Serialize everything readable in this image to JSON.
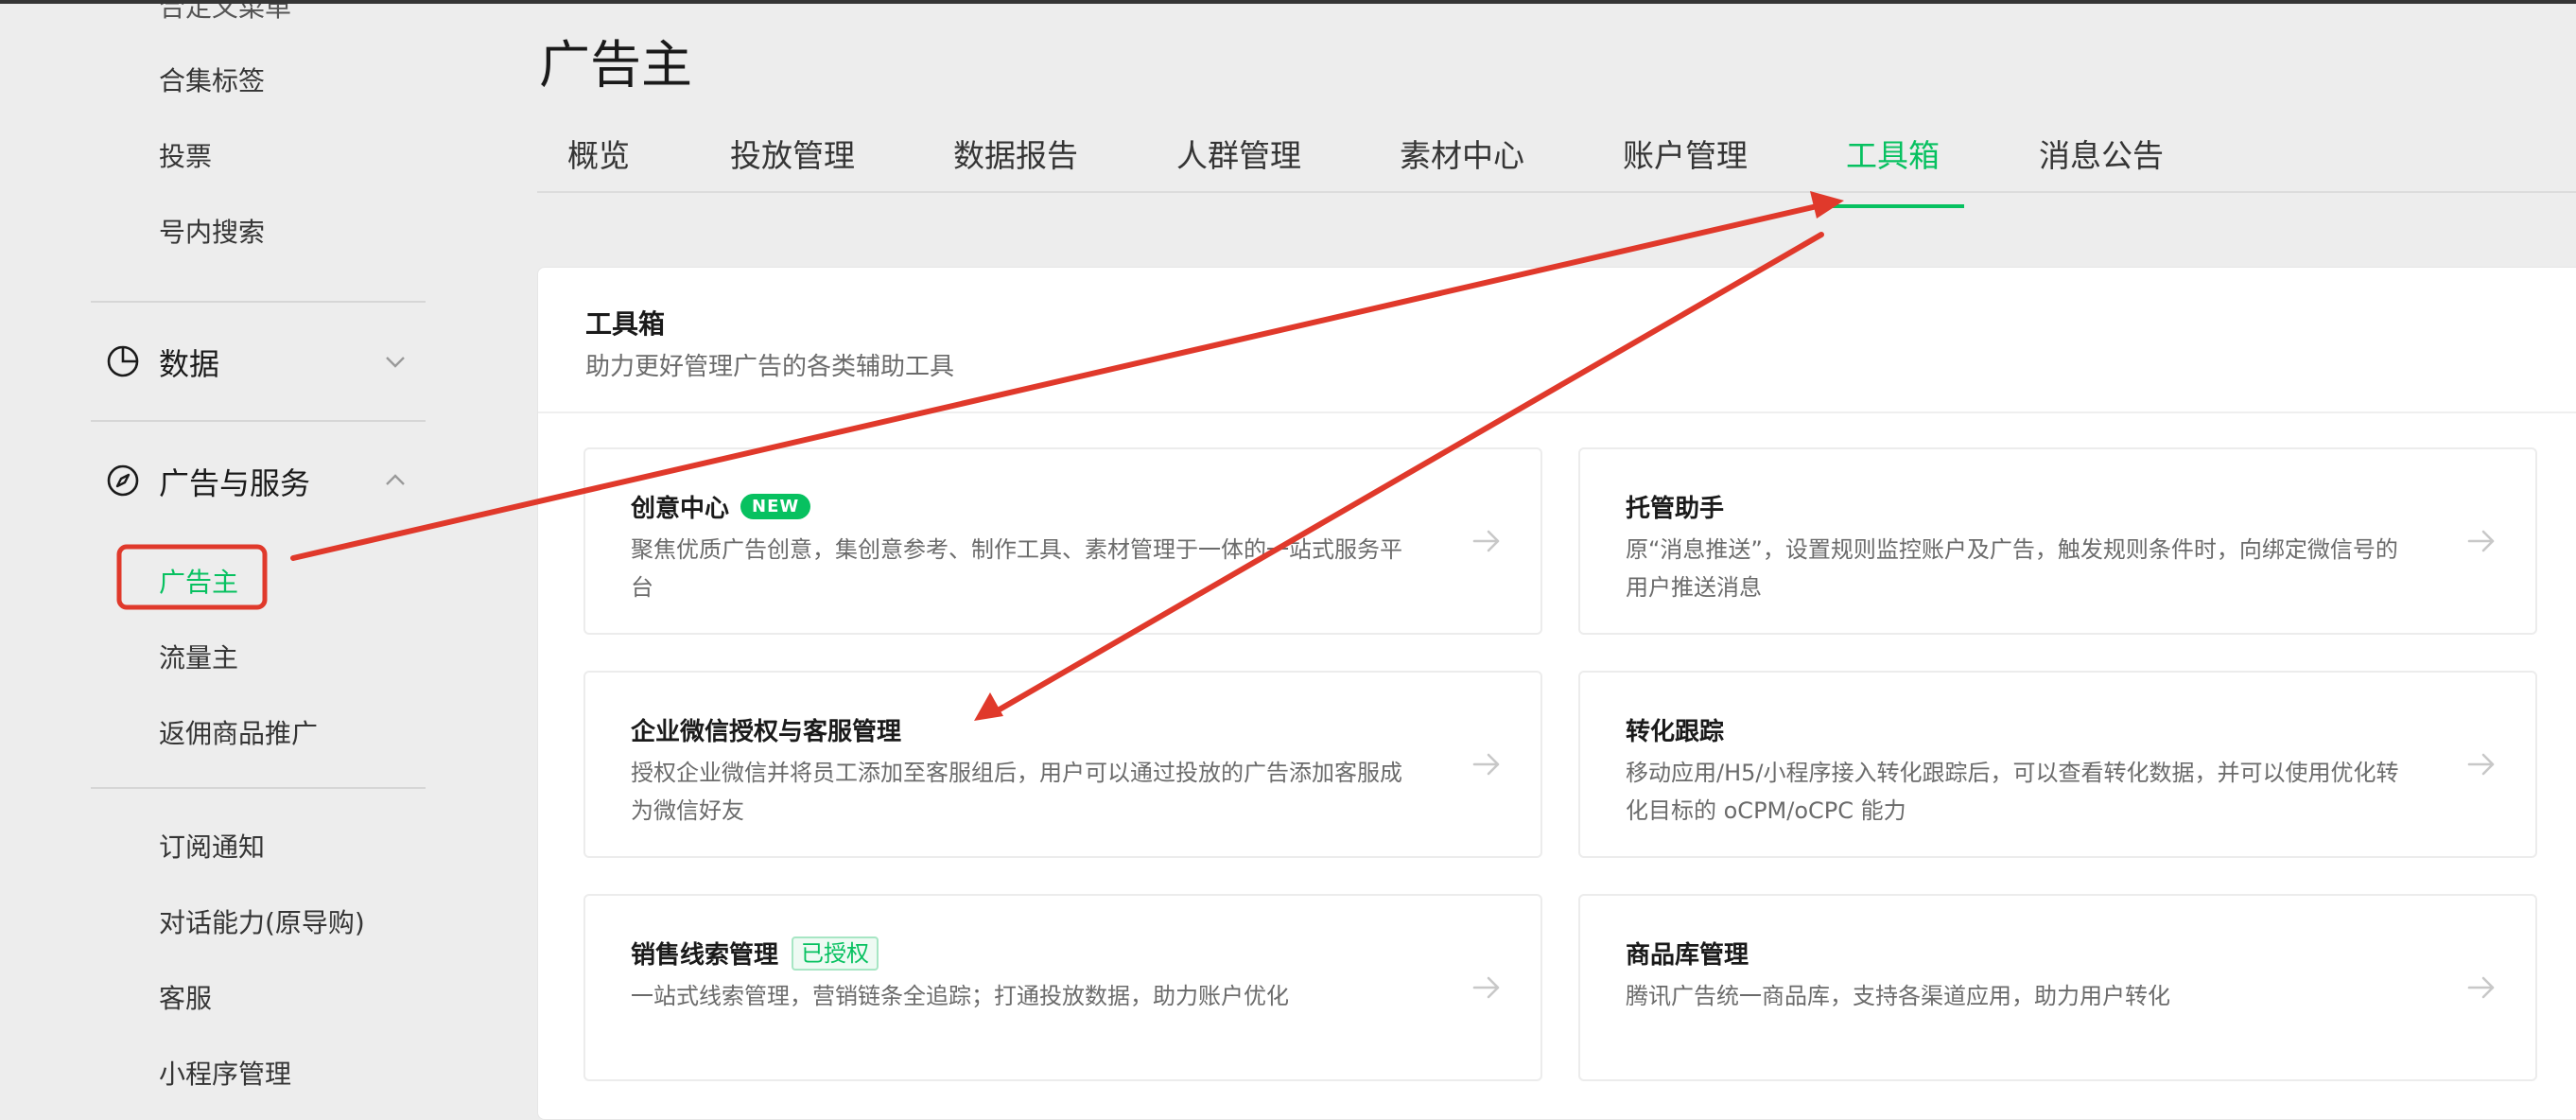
{
  "sidebar": {
    "cut_item": "合定义菜单",
    "items_top": [
      "合集标签",
      "投票",
      "号内搜索"
    ],
    "group_data": {
      "label": "数据",
      "icon": "pie-chart-icon"
    },
    "group_ads": {
      "label": "广告与服务",
      "icon": "compass-icon"
    },
    "ads_items": [
      "广告主",
      "流量主",
      "返佣商品推广"
    ],
    "items_bottom": [
      "订阅通知",
      "对话能力(原导购)",
      "客服",
      "小程序管理"
    ]
  },
  "page": {
    "title": "广告主"
  },
  "tabs": [
    "概览",
    "投放管理",
    "数据报告",
    "人群管理",
    "素材中心",
    "账户管理",
    "工具箱",
    "消息公告"
  ],
  "active_tab": "工具箱",
  "toolbox": {
    "title": "工具箱",
    "subtitle": "助力更好管理广告的各类辅助工具",
    "cards": [
      {
        "title": "创意中心",
        "badge": "NEW",
        "desc": "聚焦优质广告创意，集创意参考、制作工具、素材管理于一体的一站式服务平台"
      },
      {
        "title": "托管助手",
        "desc": "原“消息推送”，设置规则监控账户及广告，触发规则条件时，向绑定微信号的用户推送消息"
      },
      {
        "title": "企业微信授权与客服管理",
        "desc": "授权企业微信并将员工添加至客服组后，用户可以通过投放的广告添加客服成为微信好友"
      },
      {
        "title": "转化跟踪",
        "desc": "移动应用/H5/小程序接入转化跟踪后，可以查看转化数据，并可以使用优化转化目标的 oCPM/oCPC 能力"
      },
      {
        "title": "销售线索管理",
        "badge": "已授权",
        "desc": "一站式线索管理，营销链条全追踪；打通投放数据，助力账户优化"
      },
      {
        "title": "商品库管理",
        "desc": "腾讯广告统一商品库，支持各渠道应用，助力用户转化"
      }
    ]
  },
  "colors": {
    "accent": "#07c160",
    "annotation": "#e0392b"
  }
}
